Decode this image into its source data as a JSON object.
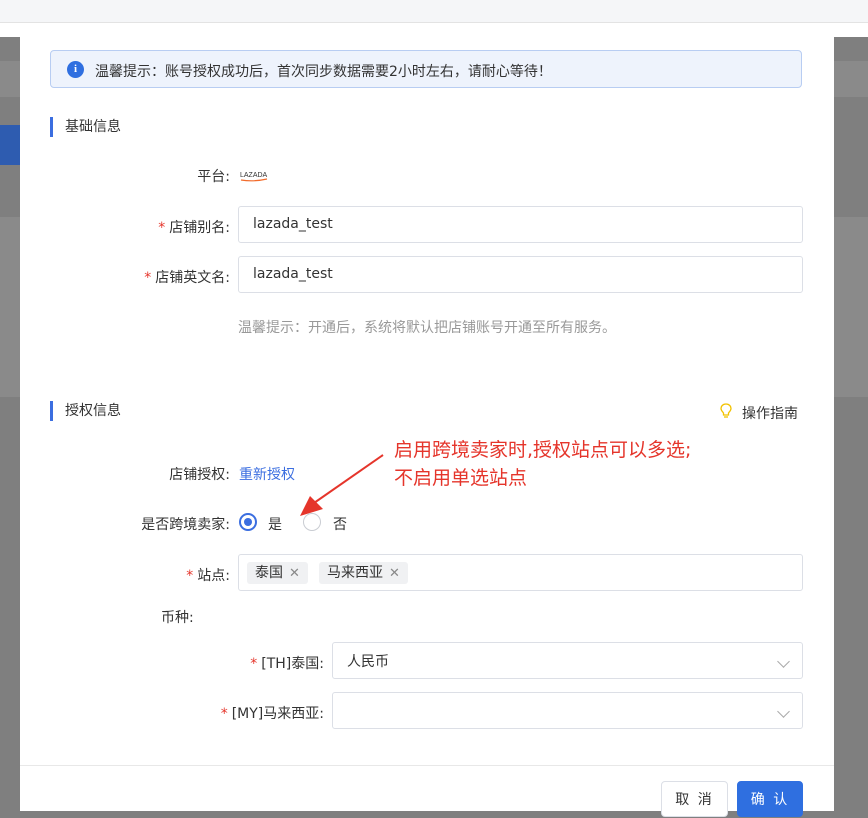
{
  "alert": {
    "text": "温馨提示：账号授权成功后，首次同步数据需要2小时左右，请耐心等待！"
  },
  "basic": {
    "title": "基础信息",
    "platform_label": "平台:",
    "platform_logo_text": "LAZADA",
    "shop_alias_label": "店铺别名:",
    "shop_alias_value": "lazada_test",
    "shop_en_label": "店铺英文名:",
    "shop_en_value": "lazada_test",
    "hint": "温馨提示：开通后，系统将默认把店铺账号开通至所有服务。"
  },
  "auth": {
    "title": "授权信息",
    "guide_label": "操作指南",
    "shop_auth_label": "店铺授权:",
    "reauth_link": "重新授权",
    "cross_border_label": "是否跨境卖家:",
    "option_yes": "是",
    "option_no": "否",
    "cross_border_selected": "是",
    "sites_label": "站点:",
    "sites": [
      "泰国",
      "马来西亚"
    ],
    "currency_label": "币种:",
    "currency_rows": [
      {
        "label": "[TH]泰国:",
        "value": "人民币"
      },
      {
        "label": "[MY]马来西亚:",
        "value": ""
      }
    ]
  },
  "annotation": {
    "line1": "启用跨境卖家时,授权站点可以多选;",
    "line2": "不启用单选站点"
  },
  "footer": {
    "cancel": "取 消",
    "ok": "确 认"
  },
  "colors": {
    "primary": "#3b6ee0",
    "required": "#e5352b",
    "annotation": "#e5352b"
  }
}
